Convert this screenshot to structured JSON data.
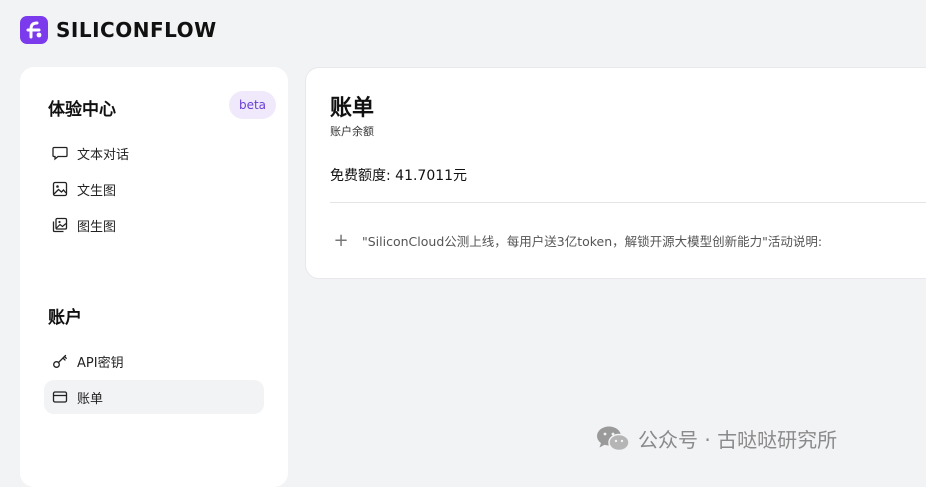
{
  "brand": {
    "name": "SILICONFLOW",
    "accent": "#7c3aed"
  },
  "sidebar": {
    "experience": {
      "title": "体验中心",
      "badge": "beta",
      "items": [
        {
          "label": "文本对话",
          "icon": "chat-bubble-icon"
        },
        {
          "label": "文生图",
          "icon": "image-icon"
        },
        {
          "label": "图生图",
          "icon": "image-stack-icon"
        }
      ]
    },
    "account": {
      "title": "账户",
      "items": [
        {
          "label": "API密钥",
          "icon": "key-icon"
        },
        {
          "label": "账单",
          "icon": "card-icon",
          "active": true
        }
      ]
    }
  },
  "main": {
    "title": "账单",
    "subtitle": "账户余额",
    "balance": "免费额度: 41.7011元",
    "notice": "\"SiliconCloud公测上线，每用户送3亿token，解锁开源大模型创新能力\"活动说明:"
  },
  "watermark": {
    "text": "公众号 · 古哒哒研究所",
    "icon": "wechat-icon"
  }
}
